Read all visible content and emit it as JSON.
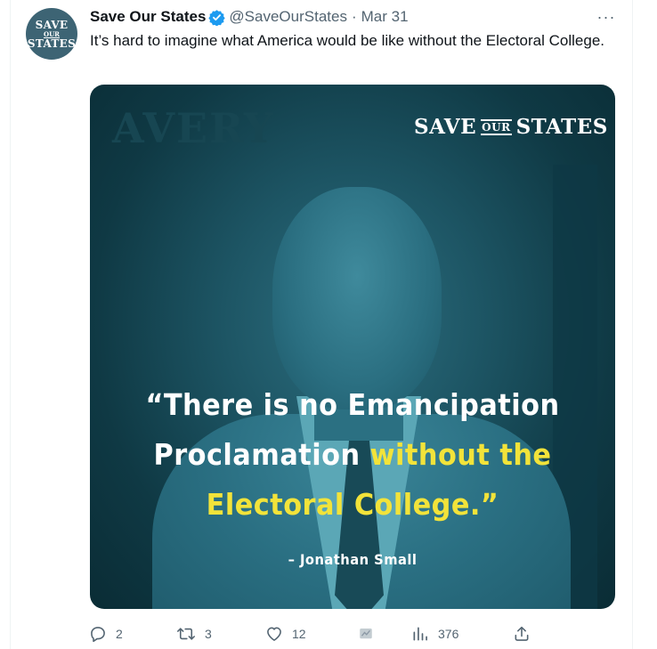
{
  "tweet": {
    "avatar_line1": "SAVE",
    "avatar_line2": "OUR",
    "avatar_line3": "STATES",
    "display_name": "Save Our States",
    "handle": "@SaveOurStates",
    "separator": "·",
    "date": "Mar 31",
    "more_label": "···",
    "text": "It’s hard to imagine what America would be like without the Electoral College."
  },
  "media": {
    "background_sign": "AVERY",
    "brand_save": "SAVE",
    "brand_our": "OUR",
    "brand_states": "STATES",
    "quote_line1": "“There is no Emancipation",
    "quote_line2_white": "Proclamation ",
    "quote_line2_yellow": "without the",
    "quote_line3": "Electoral College.”",
    "attribution": "– Jonathan Small"
  },
  "actions": {
    "reply_count": "2",
    "retweet_count": "3",
    "like_count": "12",
    "views_count": "376"
  },
  "colors": {
    "accent": "#1d9bf0",
    "text_secondary": "#536471",
    "quote_yellow": "#f2e33a",
    "image_teal": "#1d5564"
  }
}
